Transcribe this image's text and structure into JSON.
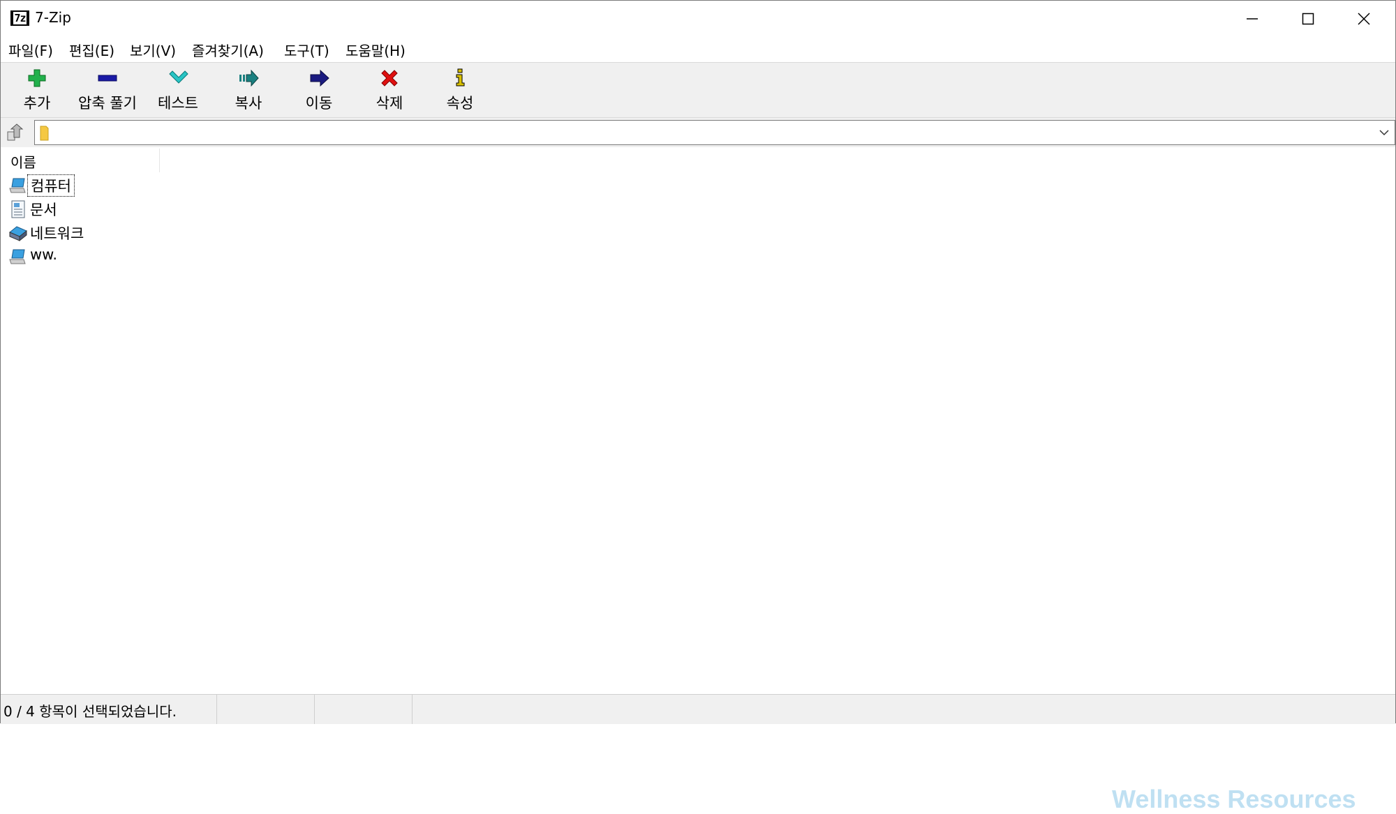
{
  "window": {
    "title": "7-Zip",
    "app_icon": "7z"
  },
  "menu": [
    {
      "label": "파일(F)"
    },
    {
      "label": "편집(E)"
    },
    {
      "label": "보기(V)"
    },
    {
      "label": "즐겨찾기(A)"
    },
    {
      "label": "도구(T)"
    },
    {
      "label": "도움말(H)"
    }
  ],
  "toolbar": {
    "buttons": [
      {
        "label": "추가",
        "icon": "add-icon",
        "color": "#22b14c"
      },
      {
        "label": "압축 풀기",
        "icon": "extract-icon",
        "color": "#1a1aa6"
      },
      {
        "label": "테스트",
        "icon": "test-icon",
        "color": "#29c5c5"
      },
      {
        "label": "복사",
        "icon": "copy-icon",
        "color": "#1a8080"
      },
      {
        "label": "이동",
        "icon": "move-icon",
        "color": "#1a1a80"
      },
      {
        "label": "삭제",
        "icon": "delete-icon",
        "color": "#e01010"
      },
      {
        "label": "속성",
        "icon": "info-icon",
        "color": "#d8c000"
      }
    ]
  },
  "address": {
    "value": "",
    "icon": "folder-icon"
  },
  "filelist": {
    "columns": [
      {
        "label": "이름"
      }
    ],
    "items": [
      {
        "label": "컴퓨터",
        "icon": "computer-icon"
      },
      {
        "label": "문서",
        "icon": "document-icon"
      },
      {
        "label": "네트워크",
        "icon": "network-icon"
      },
      {
        "label": "ww.",
        "icon": "computer-icon"
      }
    ]
  },
  "watermark": "Wellness Resources",
  "status": {
    "selection": "0 / 4 항목이 선택되었습니다."
  }
}
